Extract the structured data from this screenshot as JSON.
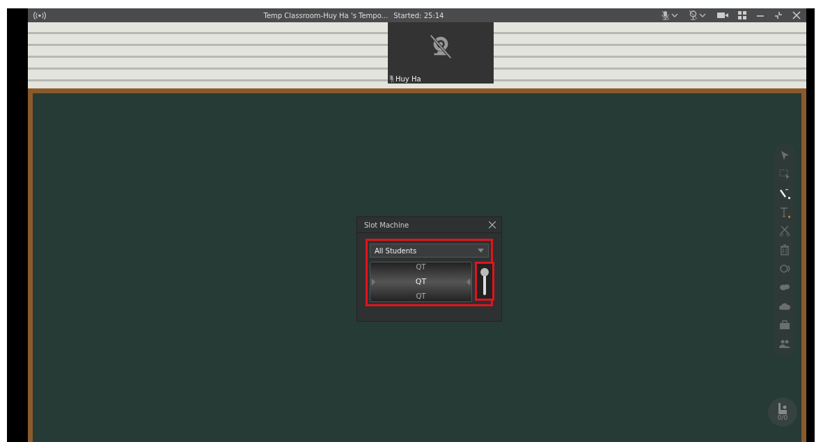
{
  "window": {
    "title": "Temp Classroom-Huy Ha 's Tempo...",
    "timer": "Started: 25:14"
  },
  "video_tile": {
    "name": "Huy Ha"
  },
  "dialog": {
    "title": "Slot Machine",
    "dropdown": "All Students",
    "reel": [
      "QT",
      "QT",
      "QT"
    ]
  },
  "tools": [
    {
      "kind": "pointer",
      "selected": false
    },
    {
      "kind": "select",
      "selected": false
    },
    {
      "kind": "pen",
      "selected": true
    },
    {
      "kind": "text",
      "selected": false
    },
    {
      "kind": "scissors",
      "selected": false
    },
    {
      "kind": "trash",
      "selected": false
    },
    {
      "kind": "shape",
      "selected": false
    },
    {
      "kind": "chat",
      "selected": false
    },
    {
      "kind": "cloud",
      "selected": false
    },
    {
      "kind": "toolbox",
      "selected": false
    },
    {
      "kind": "users",
      "selected": false
    }
  ],
  "hand_count": "0/0"
}
